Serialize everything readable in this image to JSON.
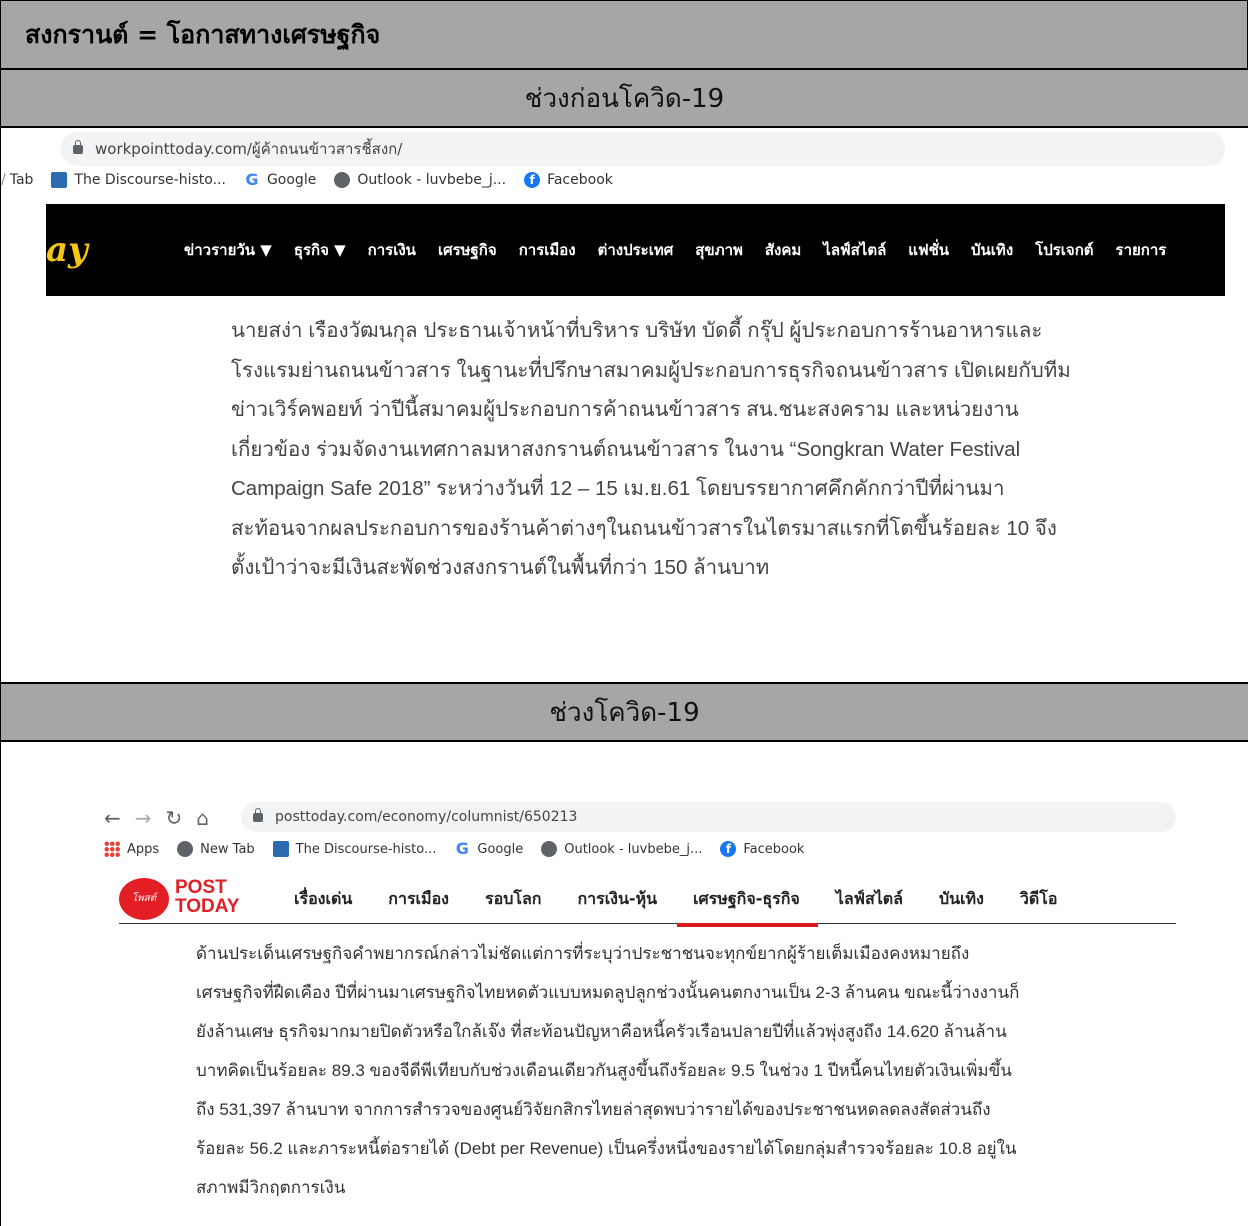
{
  "title": "สงกรานต์ = โอกาสทางเศรษฐกิจ",
  "section1": {
    "header": "ช่วงก่อนโควิด-19",
    "browser": {
      "url": "workpointtoday.com/ผู้ค้าถนนข้าวสารชี้สงก/",
      "bookmarks": [
        "Tab",
        "The Discourse-histo...",
        "Google",
        "Outlook - luvbebe_j...",
        "Facebook"
      ]
    },
    "site": {
      "logo": "ay",
      "nav": [
        "ข่าวรายวัน ▼",
        "ธุรกิจ ▼",
        "การเงิน",
        "เศรษฐกิจ",
        "การเมือง",
        "ต่างประเทศ",
        "สุขภาพ",
        "สังคม",
        "ไลฟ์สไตล์",
        "แฟชั่น",
        "บันเทิง",
        "โปรเจกต์",
        "รายการ"
      ]
    },
    "article_lines": [
      "นายสง่า เรืองวัฒนกุล ประธานเจ้าหน้าที่บริหาร บริษัท บัดดี้ กรุ๊ป ผู้ประกอบการร้านอาหารและ",
      "โรงแรมย่านถนนข้าวสาร ในฐานะที่ปรึกษาสมาคมผู้ประกอบการธุรกิจถนนข้าวสาร เปิดเผยกับทีม",
      "ข่าวเวิร์คพอยท์ ว่าปีนี้สมาคมผู้ประกอบการค้าถนนข้าวสาร สน.ชนะสงคราม และหน่วยงาน",
      "เกี่ยวข้อง ร่วมจัดงานเทศกาลมหาสงกรานต์ถนนข้าวสาร ในงาน “Songkran Water Festival",
      "Campaign Safe 2018” ระหว่างวันที่ 12 – 15 เม.ย.61 โดยบรรยากาศคึกคักกว่าปีที่ผ่านมา",
      "สะท้อนจากผลประกอบการของร้านค้าต่างๆในถนนข้าวสารในไตรมาสแรกที่โตขึ้นร้อยละ 10 จึง",
      "ตั้งเป้าว่าจะมีเงินสะพัดช่วงสงกรานต์ในพื้นที่กว่า 150 ล้านบาท"
    ]
  },
  "section2": {
    "header": "ช่วงโควิด-19",
    "browser": {
      "url": "posttoday.com/economy/columnist/650213",
      "bookmarks": [
        "Apps",
        "New Tab",
        "The Discourse-histo...",
        "Google",
        "Outlook - luvbebe_j...",
        "Facebook"
      ]
    },
    "site": {
      "logo_line1": "POST",
      "logo_line2": "TODAY",
      "logo_badge": "โพสต์",
      "nav": [
        "เรื่องเด่น",
        "การเมือง",
        "รอบโลก",
        "การเงิน-หุ้น",
        "เศรษฐกิจ-ธุรกิจ",
        "ไลฟ์สไตล์",
        "บันเทิง",
        "วิดีโอ"
      ],
      "active_nav": "เศรษฐกิจ-ธุรกิจ"
    },
    "article_lines": [
      "ด้านประเด็นเศรษฐกิจคำพยากรณ์กล่าวไม่ชัดแต่การที่ระบุว่าประชาชนจะทุกข์ยากผู้ร้ายเต็มเมืองคงหมายถึง",
      "เศรษฐกิจที่ฝืดเคือง ปีที่ผ่านมาเศรษฐกิจไทยหดตัวแบบหมดลูปลูกช่วงนั้นคนตกงานเป็น 2-3 ล้านคน ขณะนี้ว่างงานก็",
      "ยังล้านเศษ ธุรกิจมากมายปิดตัวหรือใกล้เจ๊ง ที่สะท้อนปัญหาคือหนี้ครัวเรือนปลายปีที่แล้วพุ่งสูงถึง 14.620 ล้านล้าน",
      "บาทคิดเป็นร้อยละ 89.3 ของจีดีพีเทียบกับช่วงเดือนเดียวกันสูงขึ้นถึงร้อยละ 9.5 ในช่วง 1 ปีหนี้คนไทยตัวเงินเพิ่มขึ้น",
      "ถึง 531,397 ล้านบาท จากการสำรวจของศูนย์วิจัยกสิกรไทยล่าสุดพบว่ารายได้ของประชาชนหดลดลงสัดส่วนถึง",
      "ร้อยละ 56.2 และภาระหนี้ต่อรายได้ (Debt per Revenue) เป็นครึ่งหนึ่งของรายได้โดยกลุ่มสำรวจร้อยละ 10.8 อยู่ใน",
      "สภาพมีวิกฤตการเงิน"
    ]
  }
}
